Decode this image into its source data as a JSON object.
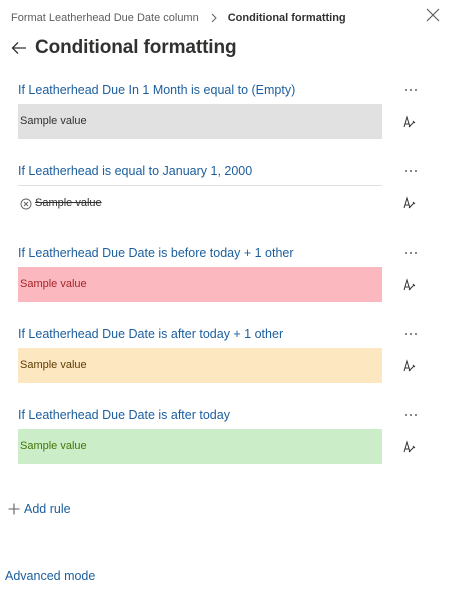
{
  "breadcrumb": {
    "parent": "Format Leatherhead Due Date column",
    "current": "Conditional formatting"
  },
  "page": {
    "title": "Conditional formatting"
  },
  "rules": [
    {
      "title": "If Leatherhead Due In 1 Month is equal to (Empty)",
      "sample": "Sample value",
      "style": "gray",
      "bg": "#e1e1e1",
      "fg": "#323130"
    },
    {
      "title": "If Leatherhead is equal to January 1, 2000",
      "sample": "Sample value",
      "style": "strikethrough",
      "bg": "#ffffff",
      "fg": "#323130"
    },
    {
      "title": "If Leatherhead Due Date is before today + 1 other",
      "sample": "Sample value",
      "style": "red",
      "bg": "#fbb9bf",
      "fg": "#a4262c"
    },
    {
      "title": "If Leatherhead Due Date is after today + 1 other",
      "sample": "Sample value",
      "style": "yellow",
      "bg": "#fde7c0",
      "fg": "#5c3d05"
    },
    {
      "title": "If Leatherhead Due Date is after today",
      "sample": "Sample value",
      "style": "green",
      "bg": "#cbeec9",
      "fg": "#437406"
    }
  ],
  "actions": {
    "add_rule": "Add rule",
    "advanced_mode": "Advanced mode"
  },
  "icons": {
    "close": "close-icon",
    "back": "back-arrow-icon",
    "more": "more-icon",
    "edit": "format-painter-icon",
    "add": "plus-icon"
  },
  "colors": {
    "link": "#1b5e9e",
    "text": "#323130"
  }
}
